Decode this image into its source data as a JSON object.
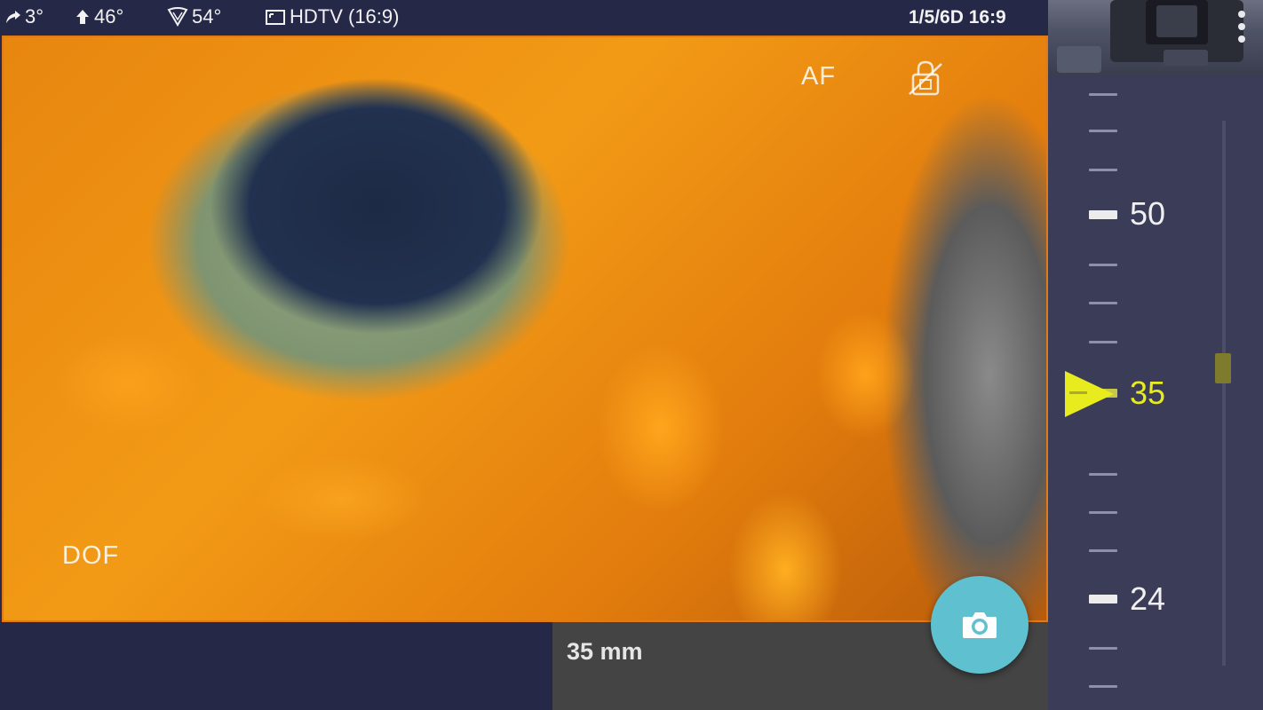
{
  "status": {
    "tilt": "3°",
    "elevation": "46°",
    "fov": "54°",
    "format": "HDTV (16:9)",
    "date": "1/5/6D 16:9"
  },
  "viewfinder": {
    "af_label": "AF",
    "dof_label": "DOF"
  },
  "focal": {
    "readout": "35 mm",
    "current": 35,
    "scale_labels": [
      "50",
      "35",
      "24"
    ]
  },
  "colors": {
    "accent_border": "#e07a1a",
    "fab": "#5fc1cf",
    "active_marker": "#e8ec1e"
  },
  "icons": [
    "tilt-icon",
    "elevation-icon",
    "fov-icon",
    "aspect-icon",
    "lock-icon",
    "camera-icon"
  ]
}
